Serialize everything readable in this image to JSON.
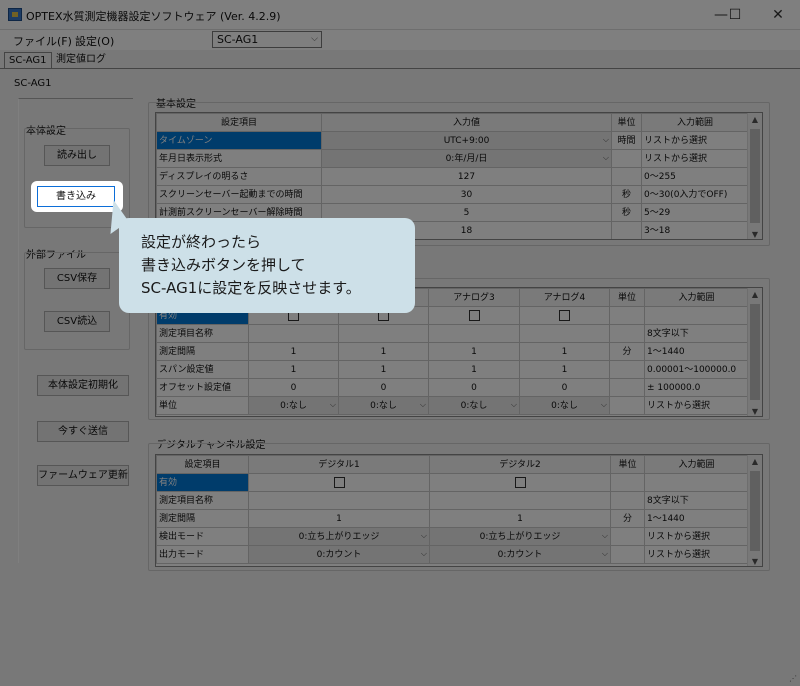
{
  "window": {
    "title": "OPTEX水質測定機器設定ソフトウェア (Ver. 4.2.9)",
    "minimize": "—",
    "maximize": "☐",
    "close": "✕"
  },
  "menu": {
    "file": "ファイル(F)",
    "settings": "設定(O)"
  },
  "device_select": {
    "value": "SC-AG1"
  },
  "tabs": [
    {
      "label": "SC-AG1"
    },
    {
      "label": "測定値ログ"
    }
  ],
  "device_label": "SC-AG1",
  "left_panel": {
    "body_settings": "本体設定",
    "read_button": "読み出し",
    "write_button": "書き込み",
    "external_file": "外部ファイル",
    "csv_save": "CSV保存",
    "csv_load": "CSV読込",
    "init_button": "本体設定初期化",
    "send_now": "今すぐ送信",
    "firmware_update": "ファームウェア更新"
  },
  "basic": {
    "title": "基本設定",
    "headers": [
      "設定項目",
      "入力値",
      "単位",
      "入力範囲"
    ],
    "rows": [
      {
        "name": "タイムゾーン",
        "value": "UTC+9:00",
        "unit": "時間",
        "range": "リストから選択"
      },
      {
        "name": "年月日表示形式",
        "value": "0:年/月/日",
        "unit": "",
        "range": "リストから選択"
      },
      {
        "name": "ディスプレイの明るさ",
        "value": "127",
        "unit": "",
        "range": "0～255"
      },
      {
        "name": "スクリーンセーバー起動までの時間",
        "value": "30",
        "unit": "秒",
        "range": "0～30(0入力でOFF)"
      },
      {
        "name": "計測前スクリーンセーバー解除時間",
        "value": "5",
        "unit": "秒",
        "range": "5～29"
      },
      {
        "name": "",
        "value": "18",
        "unit": "",
        "range": "3～18"
      }
    ]
  },
  "analog": {
    "headers": [
      "アナログ3",
      "アナログ4",
      "単位",
      "入力範囲"
    ],
    "rows": [
      {
        "name": "有効",
        "a1": "",
        "a2": "",
        "a3": "",
        "a4": "",
        "unit": "",
        "range": ""
      },
      {
        "name": "測定項目名称",
        "a1": "",
        "a2": "",
        "a3": "",
        "a4": "",
        "unit": "",
        "range": "8文字以下"
      },
      {
        "name": "測定間隔",
        "a1": "1",
        "a2": "1",
        "a3": "1",
        "a4": "1",
        "unit": "分",
        "range": "1～1440"
      },
      {
        "name": "スパン設定値",
        "a1": "1",
        "a2": "1",
        "a3": "1",
        "a4": "1",
        "unit": "",
        "range": "0.00001～100000.0"
      },
      {
        "name": "オフセット設定値",
        "a1": "0",
        "a2": "0",
        "a3": "0",
        "a4": "0",
        "unit": "",
        "range": "± 100000.0"
      },
      {
        "name": "単位",
        "a1": "0:なし",
        "a2": "0:なし",
        "a3": "0:なし",
        "a4": "0:なし",
        "unit": "",
        "range": "リストから選択"
      }
    ]
  },
  "digital": {
    "title": "デジタルチャンネル設定",
    "headers": [
      "設定項目",
      "デジタル1",
      "デジタル2",
      "単位",
      "入力範囲"
    ],
    "rows": [
      {
        "name": "有効",
        "d1": "",
        "d2": "",
        "unit": "",
        "range": ""
      },
      {
        "name": "測定項目名称",
        "d1": "",
        "d2": "",
        "unit": "",
        "range": "8文字以下"
      },
      {
        "name": "測定間隔",
        "d1": "1",
        "d2": "1",
        "unit": "分",
        "range": "1～1440"
      },
      {
        "name": "検出モード",
        "d1": "0:立ち上がりエッジ",
        "d2": "0:立ち上がりエッジ",
        "unit": "",
        "range": "リストから選択"
      },
      {
        "name": "出力モード",
        "d1": "0:カウント",
        "d2": "0:カウント",
        "unit": "",
        "range": "リストから選択"
      }
    ]
  },
  "callout": {
    "line1": "設定が終わったら",
    "line2": "書き込みボタンを押して",
    "line3": "SC-AG1に設定を反映させます。"
  },
  "icons": {
    "scroll_up": "▲",
    "scroll_down": "▼",
    "dropdown": "⌵",
    "resize": "⋰"
  }
}
